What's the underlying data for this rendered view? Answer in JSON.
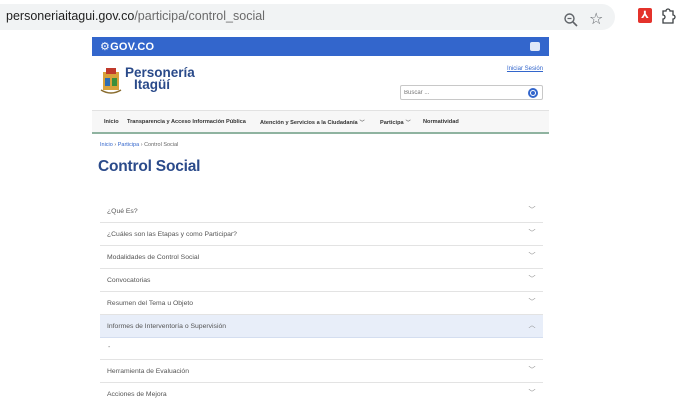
{
  "browser": {
    "url_host": "personeriaitagui.gov.co",
    "url_path": "/participa/control_social",
    "icons": [
      "zoom-icon",
      "star-icon",
      "pdf-extension-icon",
      "puzzle-extensions-icon"
    ]
  },
  "gov_bar": {
    "logo_text": "GOV.CO",
    "color": "#3366cc"
  },
  "header": {
    "brand_line1": "Personería",
    "brand_line2": "Itagüí",
    "login_link": "Iniciar Sesión",
    "search_placeholder": "Buscar ..."
  },
  "nav": {
    "items": [
      {
        "label": "Inicio",
        "dropdown": false
      },
      {
        "label": "Transparencia y Acceso Información Pública",
        "dropdown": false
      },
      {
        "label": "Atención y Servicios a la Ciudadanía",
        "dropdown": true
      },
      {
        "label": "Participa",
        "dropdown": true
      },
      {
        "label": "Normatividad",
        "dropdown": false
      }
    ]
  },
  "breadcrumb": {
    "items": [
      "Inicio",
      "Participa",
      "Control Social"
    ],
    "separator": "›"
  },
  "page": {
    "title": "Control Social"
  },
  "accordion": {
    "items": [
      {
        "label": "¿Qué Es?",
        "open": false
      },
      {
        "label": "¿Cuáles son las Etapas y como Participar?",
        "open": false
      },
      {
        "label": "Modalidades de Control Social",
        "open": false
      },
      {
        "label": "Convocatorias",
        "open": false
      },
      {
        "label": "Resumen del Tema u Objeto",
        "open": false
      },
      {
        "label": "Informes de Interventoría o Supervisión",
        "open": true
      },
      {
        "label": "Herramienta de Evaluación",
        "open": false
      },
      {
        "label": "Acciones de Mejora",
        "open": false
      }
    ],
    "open_body_text": "-",
    "chevron_closed": "﹀",
    "chevron_open": "︿"
  }
}
